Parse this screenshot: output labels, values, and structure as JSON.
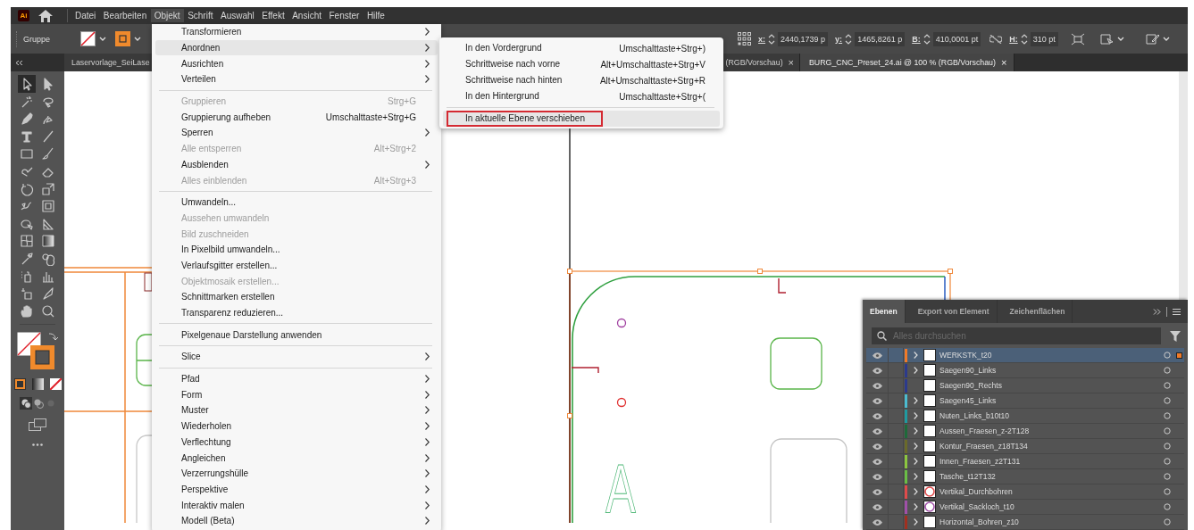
{
  "app": {
    "logo": "Ai"
  },
  "menubar": [
    {
      "label": "Datei",
      "selected": false
    },
    {
      "label": "Bearbeiten",
      "selected": false
    },
    {
      "label": "Objekt",
      "selected": true
    },
    {
      "label": "Schrift",
      "selected": false
    },
    {
      "label": "Auswahl",
      "selected": false
    },
    {
      "label": "Effekt",
      "selected": false
    },
    {
      "label": "Ansicht",
      "selected": false
    },
    {
      "label": "Fenster",
      "selected": false
    },
    {
      "label": "Hilfe",
      "selected": false
    }
  ],
  "control_bar": {
    "selection_label": "Gruppe",
    "fields": [
      {
        "label": "x:",
        "value": "2440,1739 p"
      },
      {
        "label": "y:",
        "value": "1465,8261 p"
      },
      {
        "label": "B:",
        "value": "410,0001 pt"
      },
      {
        "label": "H:",
        "value": "310 pt"
      }
    ]
  },
  "document_tabs": [
    {
      "label": "Laservorlage_SeiLase",
      "selected": false
    },
    {
      "label": "(RGB/Vorschau)",
      "selected": false,
      "close": "×"
    },
    {
      "label": "BURG_CNC_Preset_24.ai @ 100 % (RGB/Vorschau)",
      "selected": true,
      "close": "×"
    }
  ],
  "menu": {
    "sections": [
      [
        {
          "label": "Transformieren",
          "submenu": true,
          "disabled": false,
          "selected": false
        },
        {
          "label": "Anordnen",
          "submenu": true,
          "disabled": false,
          "selected": true
        },
        {
          "label": "Ausrichten",
          "submenu": true,
          "disabled": false,
          "selected": false
        },
        {
          "label": "Verteilen",
          "submenu": true,
          "disabled": false,
          "selected": false
        }
      ],
      [
        {
          "label": "Gruppieren",
          "shortcut": "Strg+G",
          "submenu": false,
          "disabled": true,
          "selected": false
        },
        {
          "label": "Gruppierung aufheben",
          "shortcut": "Umschalttaste+Strg+G",
          "submenu": false,
          "disabled": false,
          "selected": false
        },
        {
          "label": "Sperren",
          "submenu": true,
          "disabled": false,
          "selected": false
        },
        {
          "label": "Alle entsperren",
          "shortcut": "Alt+Strg+2",
          "submenu": false,
          "disabled": true,
          "selected": false
        },
        {
          "label": "Ausblenden",
          "submenu": true,
          "disabled": false,
          "selected": false
        },
        {
          "label": "Alles einblenden",
          "shortcut": "Alt+Strg+3",
          "submenu": false,
          "disabled": true,
          "selected": false
        }
      ],
      [
        {
          "label": "Umwandeln...",
          "submenu": false,
          "disabled": false,
          "selected": false
        },
        {
          "label": "Aussehen umwandeln",
          "submenu": false,
          "disabled": true,
          "selected": false
        },
        {
          "label": "Bild zuschneiden",
          "submenu": false,
          "disabled": true,
          "selected": false
        },
        {
          "label": "In Pixelbild umwandeln...",
          "submenu": false,
          "disabled": false,
          "selected": false
        },
        {
          "label": "Verlaufsgitter erstellen...",
          "submenu": false,
          "disabled": false,
          "selected": false
        },
        {
          "label": "Objektmosaik erstellen...",
          "submenu": false,
          "disabled": true,
          "selected": false
        },
        {
          "label": "Schnittmarken erstellen",
          "submenu": false,
          "disabled": false,
          "selected": false
        },
        {
          "label": "Transparenz reduzieren...",
          "submenu": false,
          "disabled": false,
          "selected": false
        }
      ],
      [
        {
          "label": "Pixelgenaue Darstellung anwenden",
          "submenu": false,
          "disabled": false,
          "selected": false
        }
      ],
      [
        {
          "label": "Slice",
          "submenu": true,
          "disabled": false,
          "selected": false
        }
      ],
      [
        {
          "label": "Pfad",
          "submenu": true,
          "disabled": false,
          "selected": false
        },
        {
          "label": "Form",
          "submenu": true,
          "disabled": false,
          "selected": false
        },
        {
          "label": "Muster",
          "submenu": true,
          "disabled": false,
          "selected": false
        },
        {
          "label": "Wiederholen",
          "submenu": true,
          "disabled": false,
          "selected": false
        },
        {
          "label": "Verflechtung",
          "submenu": true,
          "disabled": false,
          "selected": false
        },
        {
          "label": "Angleichen",
          "submenu": true,
          "disabled": false,
          "selected": false
        },
        {
          "label": "Verzerrungshülle",
          "submenu": true,
          "disabled": false,
          "selected": false
        },
        {
          "label": "Perspektive",
          "submenu": true,
          "disabled": false,
          "selected": false
        },
        {
          "label": "Interaktiv malen",
          "submenu": true,
          "disabled": false,
          "selected": false
        },
        {
          "label": "Modell (Beta)",
          "submenu": true,
          "disabled": false,
          "selected": false
        }
      ]
    ]
  },
  "submenu": {
    "sections": [
      [
        {
          "label": "In den Vordergrund",
          "shortcut": "Umschalttaste+Strg+)",
          "selected": false,
          "outlined": false
        },
        {
          "label": "Schrittweise nach vorne",
          "shortcut": "Alt+Umschalttaste+Strg+V",
          "selected": false,
          "outlined": false
        },
        {
          "label": "Schrittweise nach hinten",
          "shortcut": "Alt+Umschalttaste+Strg+R",
          "selected": false,
          "outlined": false
        },
        {
          "label": "In den Hintergrund",
          "shortcut": "Umschalttaste+Strg+(",
          "selected": false,
          "outlined": false
        }
      ],
      [
        {
          "label": "In aktuelle Ebene verschieben",
          "selected": true,
          "outlined": true
        }
      ]
    ]
  },
  "canvas": {
    "letter": "A"
  },
  "layers_panel": {
    "tabs": [
      {
        "label": "Ebenen",
        "selected": true
      },
      {
        "label": "Export von Element",
        "selected": false
      },
      {
        "label": "Zeichenflächen",
        "selected": false
      }
    ],
    "search": {
      "placeholder": "Alles durchsuchen"
    },
    "layers": [
      {
        "name": "WERKSTK_t20",
        "color": "#f07a28",
        "visible": true,
        "expandable": true,
        "selected": true,
        "has_selection": true,
        "thumbnail_ring": false
      },
      {
        "name": "Saegen90_Links",
        "color": "#2c3a8c",
        "visible": true,
        "expandable": true,
        "selected": false,
        "has_selection": false,
        "thumbnail_ring": false
      },
      {
        "name": "Saegen90_Rechts",
        "color": "#2c3a8c",
        "visible": true,
        "expandable": false,
        "selected": false,
        "has_selection": false,
        "thumbnail_ring": false
      },
      {
        "name": "Saegen45_Links",
        "color": "#4bbcd0",
        "visible": true,
        "expandable": true,
        "selected": false,
        "has_selection": false,
        "thumbnail_ring": false
      },
      {
        "name": "Nuten_Links_b10t10",
        "color": "#1f9aa0",
        "visible": true,
        "expandable": true,
        "selected": false,
        "has_selection": false,
        "thumbnail_ring": false
      },
      {
        "name": "Aussen_Fraesen_z-2T128",
        "color": "#1e6a3a",
        "visible": true,
        "expandable": true,
        "selected": false,
        "has_selection": false,
        "thumbnail_ring": false
      },
      {
        "name": "Kontur_Fraesen_z18T134",
        "color": "#6a6a2a",
        "visible": true,
        "expandable": true,
        "selected": false,
        "has_selection": false,
        "thumbnail_ring": false
      },
      {
        "name": "Innen_Fraesen_z2T131",
        "color": "#8cc63f",
        "visible": true,
        "expandable": true,
        "selected": false,
        "has_selection": false,
        "thumbnail_ring": false
      },
      {
        "name": "Tasche_t12T132",
        "color": "#6abe45",
        "visible": true,
        "expandable": true,
        "selected": false,
        "has_selection": false,
        "thumbnail_ring": false
      },
      {
        "name": "Vertikal_Durchbohren",
        "color": "#e04b4b",
        "visible": true,
        "expandable": true,
        "selected": false,
        "has_selection": false,
        "thumbnail_ring": true
      },
      {
        "name": "Vertikal_Sackloch_t10",
        "color": "#a050a8",
        "visible": true,
        "expandable": true,
        "selected": false,
        "has_selection": false,
        "thumbnail_ring": true
      },
      {
        "name": "Horizontal_Bohren_z10",
        "color": "#a03020",
        "visible": true,
        "expandable": true,
        "selected": false,
        "has_selection": false,
        "thumbnail_ring": false
      }
    ]
  }
}
